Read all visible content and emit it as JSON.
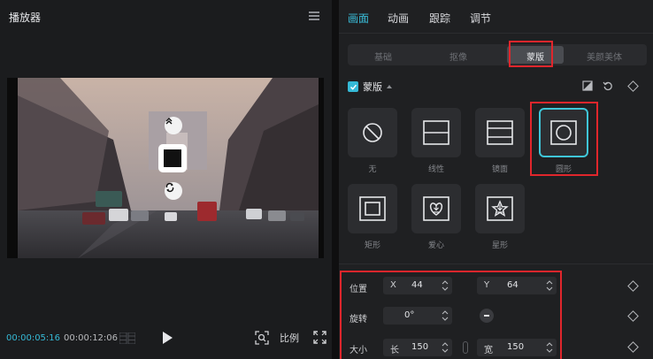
{
  "player": {
    "title": "播放器",
    "time_current": "00:00:05:16",
    "time_total": "00:00:12:06",
    "ratio_label": "比例"
  },
  "props": {
    "tabs": [
      {
        "label": "画面",
        "active": true
      },
      {
        "label": "动画",
        "active": false
      },
      {
        "label": "跟踪",
        "active": false
      },
      {
        "label": "调节",
        "active": false
      }
    ],
    "subtabs": [
      {
        "label": "基础",
        "active": false
      },
      {
        "label": "抠像",
        "active": false
      },
      {
        "label": "蒙版",
        "active": true
      },
      {
        "label": "美颜美体",
        "active": false
      }
    ],
    "section_title": "蒙版",
    "masks": [
      {
        "label": "无",
        "icon": "none-icon",
        "selected": false,
        "download": false
      },
      {
        "label": "线性",
        "icon": "linear-icon",
        "selected": false,
        "download": false
      },
      {
        "label": "镜面",
        "icon": "mirror-icon",
        "selected": false,
        "download": false
      },
      {
        "label": "圆形",
        "icon": "circle-icon",
        "selected": true,
        "download": false
      },
      {
        "label": "矩形",
        "icon": "rectangle-icon",
        "selected": false,
        "download": false
      },
      {
        "label": "爱心",
        "icon": "heart-icon",
        "selected": false,
        "download": true
      },
      {
        "label": "星形",
        "icon": "star-icon",
        "selected": false,
        "download": true
      }
    ],
    "position": {
      "label": "位置",
      "x_label": "X",
      "x": "44",
      "y_label": "Y",
      "y": "64"
    },
    "rotation": {
      "label": "旋转",
      "value": "0°"
    },
    "size": {
      "label": "大小",
      "w_label": "长",
      "w": "150",
      "h_label": "宽",
      "h": "150"
    }
  },
  "colors": {
    "accent": "#35b9d6",
    "highlight": "#e0262c"
  }
}
